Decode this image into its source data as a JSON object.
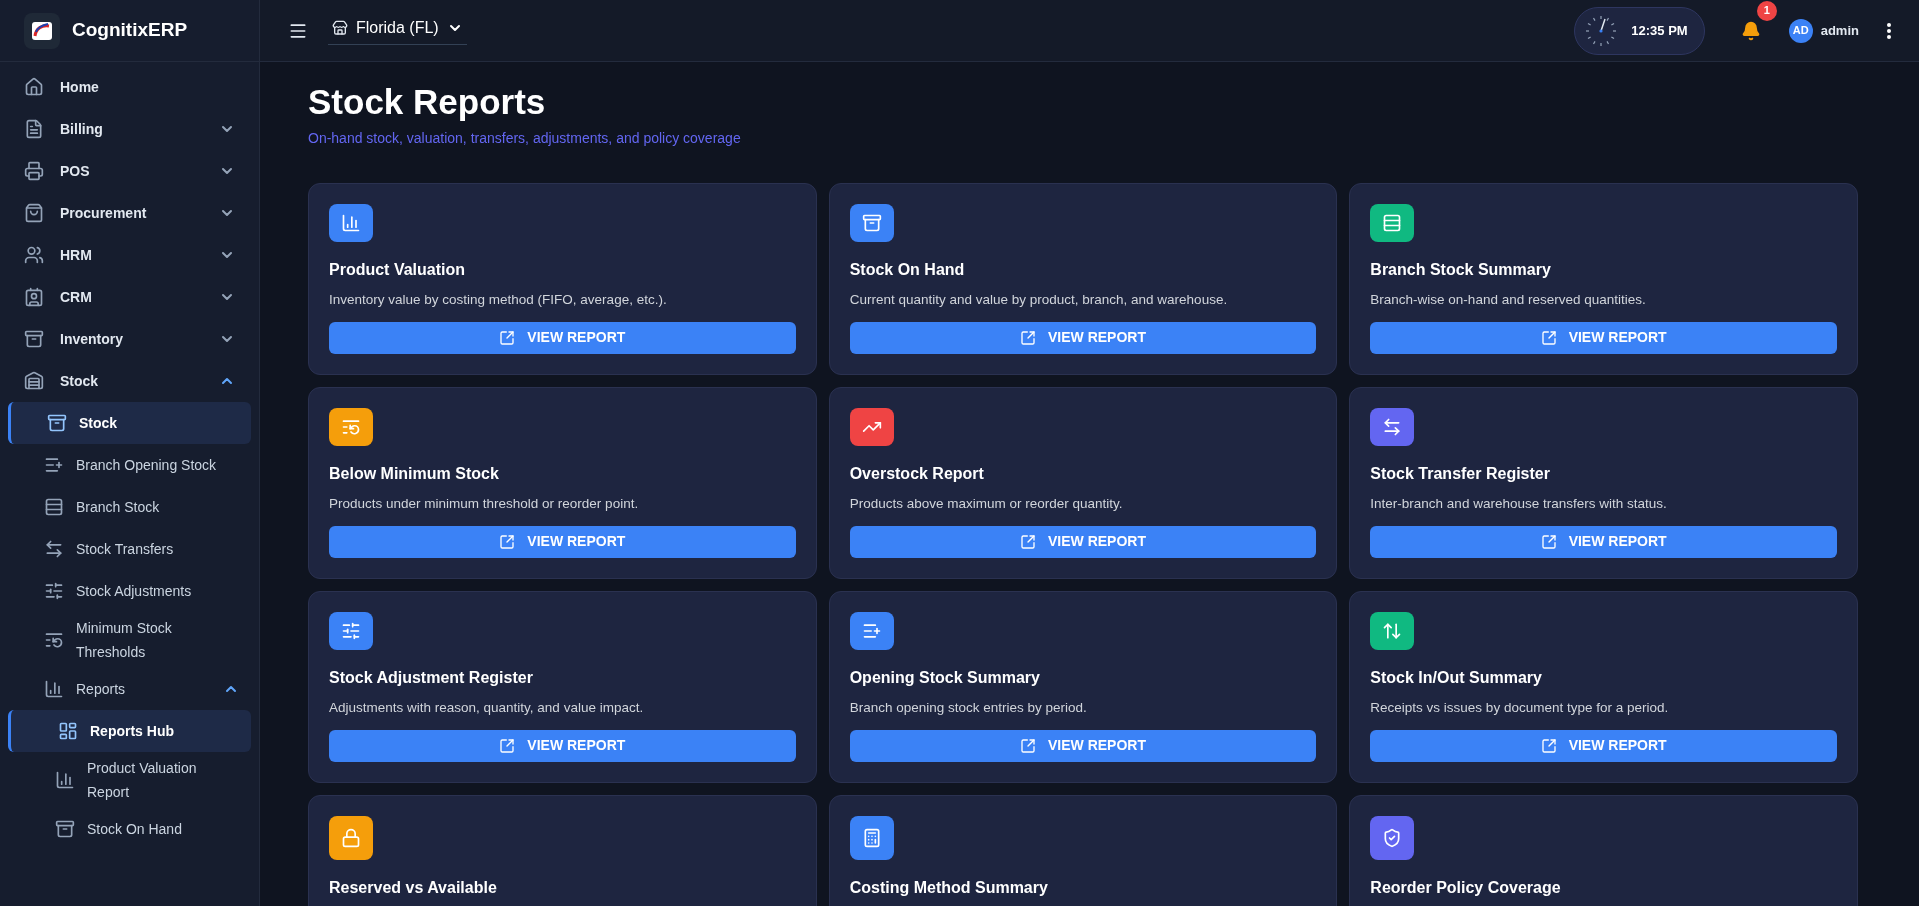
{
  "brand": {
    "name": "CognitixERP"
  },
  "sidebar": {
    "items": [
      {
        "label": "Home"
      },
      {
        "label": "Billing",
        "expanded": false
      },
      {
        "label": "POS",
        "expanded": false
      },
      {
        "label": "Procurement",
        "expanded": false
      },
      {
        "label": "HRM",
        "expanded": false
      },
      {
        "label": "CRM",
        "expanded": false
      },
      {
        "label": "Inventory",
        "expanded": false
      },
      {
        "label": "Stock",
        "expanded": true,
        "children": [
          {
            "label": "Stock",
            "selected": true
          },
          {
            "label": "Branch Opening Stock",
            "selected": false
          },
          {
            "label": "Branch Stock",
            "selected": false
          },
          {
            "label": "Stock Transfers",
            "selected": false
          },
          {
            "label": "Stock Adjustments",
            "selected": false
          },
          {
            "label": "Minimum Stock Thresholds",
            "selected": false
          },
          {
            "label": "Reports",
            "selected": false,
            "expanded": true,
            "children": [
              {
                "label": "Reports Hub",
                "selected": true
              },
              {
                "label": "Product Valuation Report",
                "selected": false
              },
              {
                "label": "Stock On Hand",
                "selected": false
              }
            ]
          }
        ]
      }
    ]
  },
  "header": {
    "branch": "Florida (FL)",
    "time": "12:35 PM",
    "notification_count": "1",
    "avatar_initials": "AD",
    "user": "admin"
  },
  "page": {
    "title": "Stock Reports",
    "subtitle": "On-hand stock, valuation, transfers, adjustments, and policy coverage"
  },
  "reports": [
    {
      "title": "Product Valuation",
      "description": "Inventory value by costing method (FIFO, average, etc.).",
      "button": "VIEW REPORT",
      "color": "#3b82f6"
    },
    {
      "title": "Stock On Hand",
      "description": "Current quantity and value by product, branch, and warehouse.",
      "button": "VIEW REPORT",
      "color": "#3b82f6"
    },
    {
      "title": "Branch Stock Summary",
      "description": "Branch-wise on-hand and reserved quantities.",
      "button": "VIEW REPORT",
      "color": "#10b981"
    },
    {
      "title": "Below Minimum Stock",
      "description": "Products under minimum threshold or reorder point.",
      "button": "VIEW REPORT",
      "color": "#f59e0b"
    },
    {
      "title": "Overstock Report",
      "description": "Products above maximum or reorder quantity.",
      "button": "VIEW REPORT",
      "color": "#ef4444"
    },
    {
      "title": "Stock Transfer Register",
      "description": "Inter-branch and warehouse transfers with status.",
      "button": "VIEW REPORT",
      "color": "#6366f1"
    },
    {
      "title": "Stock Adjustment Register",
      "description": "Adjustments with reason, quantity, and value impact.",
      "button": "VIEW REPORT",
      "color": "#3b82f6"
    },
    {
      "title": "Opening Stock Summary",
      "description": "Branch opening stock entries by period.",
      "button": "VIEW REPORT",
      "color": "#3b82f6"
    },
    {
      "title": "Stock In/Out Summary",
      "description": "Receipts vs issues by document type for a period.",
      "button": "VIEW REPORT",
      "color": "#10b981"
    },
    {
      "title": "Reserved vs Available",
      "color": "#f59e0b"
    },
    {
      "title": "Costing Method Summary",
      "color": "#3b82f6"
    },
    {
      "title": "Reorder Policy Coverage",
      "color": "#6366f1"
    }
  ]
}
